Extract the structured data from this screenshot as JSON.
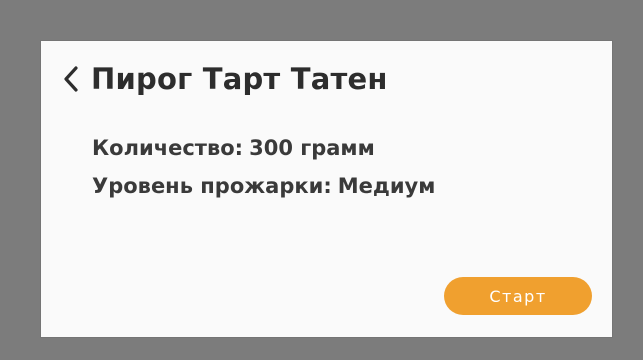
{
  "screen": {
    "title": "Пирог Тарт Татен",
    "back_icon": "chevron-left-icon"
  },
  "details": {
    "quantity_label": "Количество:",
    "quantity_value": "300 грамм",
    "doneness_label": "Уровень прожарки:",
    "doneness_value": "Медиум"
  },
  "actions": {
    "start_label": "Старт"
  },
  "colors": {
    "background": "#7c7c7c",
    "panel": "#fafafa",
    "accent": "#f0a02f",
    "text": "#2d2d2d"
  }
}
